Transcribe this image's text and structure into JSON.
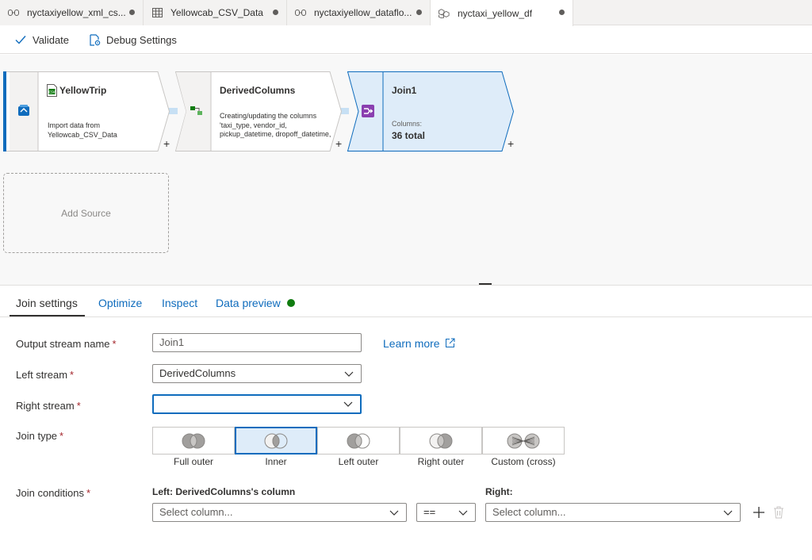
{
  "tabs": [
    {
      "label": "nyctaxiyellow_xml_cs...",
      "icon": "dataflow-icon",
      "active": false
    },
    {
      "label": "Yellowcab_CSV_Data",
      "icon": "table-icon",
      "active": false
    },
    {
      "label": "nyctaxiyellow_dataflo...",
      "icon": "dataflow-icon",
      "active": false
    },
    {
      "label": "nyctaxi_yellow_df",
      "icon": "dataflow-cubes-icon",
      "active": true
    }
  ],
  "toolbar": {
    "validate_label": "Validate",
    "debug_label": "Debug Settings"
  },
  "canvas": {
    "nodes": [
      {
        "title": "YellowTrip",
        "description": "Import data from Yellowcab_CSV_Data",
        "type": "source"
      },
      {
        "title": "DerivedColumns",
        "description": "Creating/updating the columns 'taxi_type, vendor_id, pickup_datetime, dropoff_datetime,",
        "type": "derived-column"
      },
      {
        "title": "Join1",
        "columns_label": "Columns:",
        "columns_value": "36 total",
        "type": "join"
      }
    ],
    "plus": "+",
    "add_source_label": "Add Source"
  },
  "panel": {
    "tabs": [
      "Join settings",
      "Optimize",
      "Inspect",
      "Data preview"
    ],
    "active_tab": "Join settings",
    "data_preview_status_color": "#107c10",
    "output_stream_label": "Output stream name",
    "output_stream_value": "Join1",
    "learn_more": "Learn more",
    "left_stream_label": "Left stream",
    "left_stream_value": "DerivedColumns",
    "right_stream_label": "Right stream",
    "right_stream_value": "",
    "join_type_label": "Join type",
    "join_types": [
      "Full outer",
      "Inner",
      "Left outer",
      "Right outer",
      "Custom (cross)"
    ],
    "selected_join_type": "Inner",
    "join_conditions_label": "Join conditions",
    "left_col_header": "Left: DerivedColumns's column",
    "right_col_header": "Right:",
    "left_col_placeholder": "Select column...",
    "operator_value": "==",
    "right_col_placeholder": "Select column...",
    "required_mark": "*"
  },
  "colors": {
    "accent": "#0f6cbd",
    "selected_node_fill": "#deecf9",
    "canvas_bg": "#f8f8f8",
    "required": "#a4262c"
  }
}
